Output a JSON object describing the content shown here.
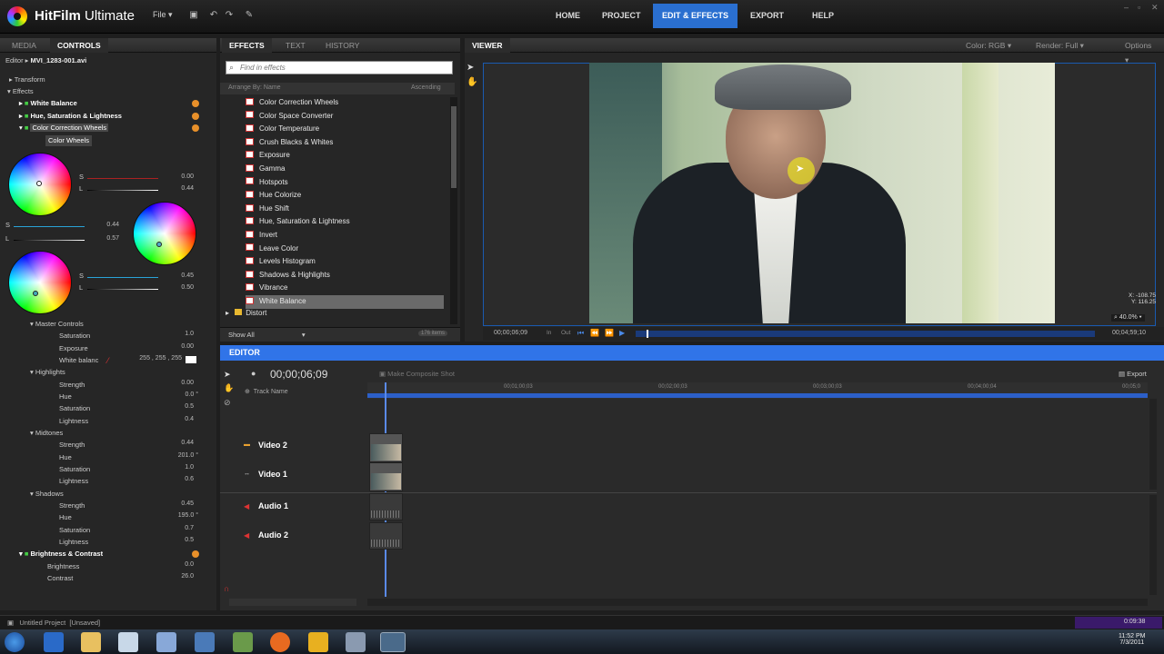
{
  "app": {
    "title_bold": "HitFilm",
    "title_light": "Ultimate"
  },
  "menu": {
    "file": "File ▾"
  },
  "nav": [
    {
      "label": "HOME",
      "active": false
    },
    {
      "label": "PROJECT",
      "active": false
    },
    {
      "label": "EDIT & EFFECTS",
      "active": true
    },
    {
      "label": "EXPORT",
      "active": false
    },
    {
      "label": "HELP",
      "active": false
    }
  ],
  "left_panel": {
    "tabs": [
      "MEDIA",
      "CONTROLS"
    ],
    "breadcrumb_prefix": "Editor",
    "breadcrumb_file": "MVI_1283-001.avi",
    "tree": {
      "transform": "Transform",
      "effects": "Effects",
      "white_balance": "White Balance",
      "hsl": "Hue, Saturation & Lightness",
      "ccw": "Color Correction Wheels",
      "ccw_sub": "Color Wheels"
    },
    "wheel1": {
      "s": "S",
      "l": "L",
      "s_val": "0.00",
      "l_val": "0.44"
    },
    "wheel2": {
      "s": "S",
      "l": "L",
      "s_val": "0.44",
      "l_val": "0.57"
    },
    "wheel3": {
      "s": "S",
      "l": "L",
      "s_val": "0.45",
      "l_val": "0.50"
    },
    "master": {
      "label": "Master Controls",
      "saturation": "Saturation",
      "saturation_val": "1.0",
      "exposure": "Exposure",
      "exposure_val": "0.00",
      "white_bal": "White balanc",
      "white_bal_val": "255 ,  255 ,  255"
    },
    "highlights": {
      "label": "Highlights",
      "strength": "Strength",
      "strength_val": "0.00",
      "hue": "Hue",
      "hue_val": "0.0 °",
      "saturation": "Saturation",
      "saturation_val": "0.5",
      "lightness": "Lightness",
      "lightness_val": "0.4"
    },
    "midtones": {
      "label": "Midtones",
      "strength": "Strength",
      "strength_val": "0.44",
      "hue": "Hue",
      "hue_val": "201.0 °",
      "saturation": "Saturation",
      "saturation_val": "1.0",
      "lightness": "Lightness",
      "lightness_val": "0.6"
    },
    "shadows": {
      "label": "Shadows",
      "strength": "Strength",
      "strength_val": "0.45",
      "hue": "Hue",
      "hue_val": "195.0 °",
      "saturation": "Saturation",
      "saturation_val": "0.7",
      "lightness": "Lightness",
      "lightness_val": "0.5"
    },
    "bc": {
      "label": "Brightness & Contrast",
      "brightness": "Brightness",
      "brightness_val": "0.0",
      "contrast": "Contrast",
      "contrast_val": "26.0"
    }
  },
  "effects_panel": {
    "tabs": [
      "EFFECTS",
      "TEXT",
      "HISTORY"
    ],
    "search_placeholder": "Find in effects",
    "arrange": "Arrange By: Name",
    "sort": "Ascending",
    "items": [
      "Color Correction Wheels",
      "Color Space Converter",
      "Color Temperature",
      "Crush Blacks & Whites",
      "Exposure",
      "Gamma",
      "Hotspots",
      "Hue Colorize",
      "Hue Shift",
      "Hue, Saturation & Lightness",
      "Invert",
      "Leave Color",
      "Levels Histogram",
      "Shadows & Highlights",
      "Vibrance",
      "White Balance"
    ],
    "selected": "White Balance",
    "folder": "Distort",
    "show": "Show All",
    "count": "176 items"
  },
  "viewer": {
    "title": "VIEWER",
    "color": "Color: RGB",
    "render": "Render: Full",
    "options": "Options",
    "x_label": "X:",
    "x_val": "-108.75",
    "y_label": "Y:",
    "y_val": "116.25",
    "zoom": "40.0%",
    "timecode": "00;00;06;09",
    "in": "In",
    "out": "Out",
    "duration": "00;04;59;10",
    "playhead_fraction": 0.023
  },
  "editor": {
    "title": "EDITOR",
    "timecode": "00;00;06;09",
    "make_composite": "Make Composite Shot",
    "export": "Export",
    "track_name": "Track Name",
    "ruler": [
      "00;01;00;03",
      "00;02;00;03",
      "00;03;00;03",
      "00;04;00;04",
      "00;05;0"
    ],
    "tracks": [
      "Video 2",
      "Video 1",
      "Audio 1",
      "Audio 2"
    ]
  },
  "status": {
    "project": "Untitled Project",
    "state": "[Unsaved]",
    "timer": "0:09:38"
  },
  "clock": {
    "time": "11:52 PM",
    "date": "7/3/2011"
  },
  "colors": {
    "accent": "#2a6fd0",
    "editor_bar": "#3074e8",
    "bg": "#262626"
  }
}
